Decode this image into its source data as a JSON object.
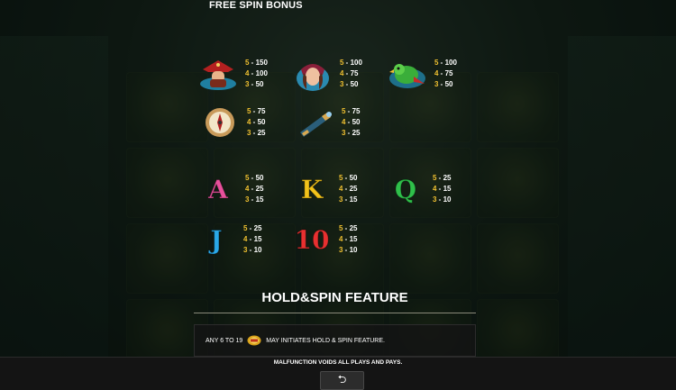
{
  "sections": {
    "free_spin_title": "FREE SPIN BONUS",
    "hold_spin_title": "HOLD&SPIN FEATURE"
  },
  "paytable": [
    {
      "symbol": "pirate-captain",
      "pays": [
        {
          "count": "5",
          "value": "150"
        },
        {
          "count": "4",
          "value": "100"
        },
        {
          "count": "3",
          "value": "50"
        }
      ]
    },
    {
      "symbol": "pirate-lady",
      "pays": [
        {
          "count": "5",
          "value": "100"
        },
        {
          "count": "4",
          "value": "75"
        },
        {
          "count": "3",
          "value": "50"
        }
      ]
    },
    {
      "symbol": "parrot",
      "pays": [
        {
          "count": "5",
          "value": "100"
        },
        {
          "count": "4",
          "value": "75"
        },
        {
          "count": "3",
          "value": "50"
        }
      ]
    },
    {
      "symbol": "compass",
      "pays": [
        {
          "count": "5",
          "value": "75"
        },
        {
          "count": "4",
          "value": "50"
        },
        {
          "count": "3",
          "value": "25"
        }
      ]
    },
    {
      "symbol": "spyglass",
      "pays": [
        {
          "count": "5",
          "value": "75"
        },
        {
          "count": "4",
          "value": "50"
        },
        {
          "count": "3",
          "value": "25"
        }
      ]
    },
    {
      "symbol": "A",
      "color": "#e8509c",
      "pays": [
        {
          "count": "5",
          "value": "50"
        },
        {
          "count": "4",
          "value": "25"
        },
        {
          "count": "3",
          "value": "15"
        }
      ]
    },
    {
      "symbol": "K",
      "color": "#f2c21a",
      "pays": [
        {
          "count": "5",
          "value": "50"
        },
        {
          "count": "4",
          "value": "25"
        },
        {
          "count": "3",
          "value": "15"
        }
      ]
    },
    {
      "symbol": "Q",
      "color": "#2fbf4a",
      "pays": [
        {
          "count": "5",
          "value": "25"
        },
        {
          "count": "4",
          "value": "15"
        },
        {
          "count": "3",
          "value": "10"
        }
      ]
    },
    {
      "symbol": "J",
      "color": "#2aa8e8",
      "pays": [
        {
          "count": "5",
          "value": "25"
        },
        {
          "count": "4",
          "value": "15"
        },
        {
          "count": "3",
          "value": "10"
        }
      ]
    },
    {
      "symbol": "10",
      "color": "#e83030",
      "pays": [
        {
          "count": "5",
          "value": "25"
        },
        {
          "count": "4",
          "value": "15"
        },
        {
          "count": "3",
          "value": "10"
        }
      ]
    }
  ],
  "hold_spin": {
    "text_before": "ANY 6 TO 19",
    "coin_icon": "gold-coin-icon",
    "text_after": "MAY INITIATES HOLD & SPIN FEATURE."
  },
  "footer": {
    "note": "MALFUNCTION VOIDS ALL PLAYS AND PAYS.",
    "back_icon": "return-arrow-icon",
    "back_glyph": "⮌"
  },
  "colors": {
    "count": "#f0c030",
    "value": "#ffffff"
  }
}
